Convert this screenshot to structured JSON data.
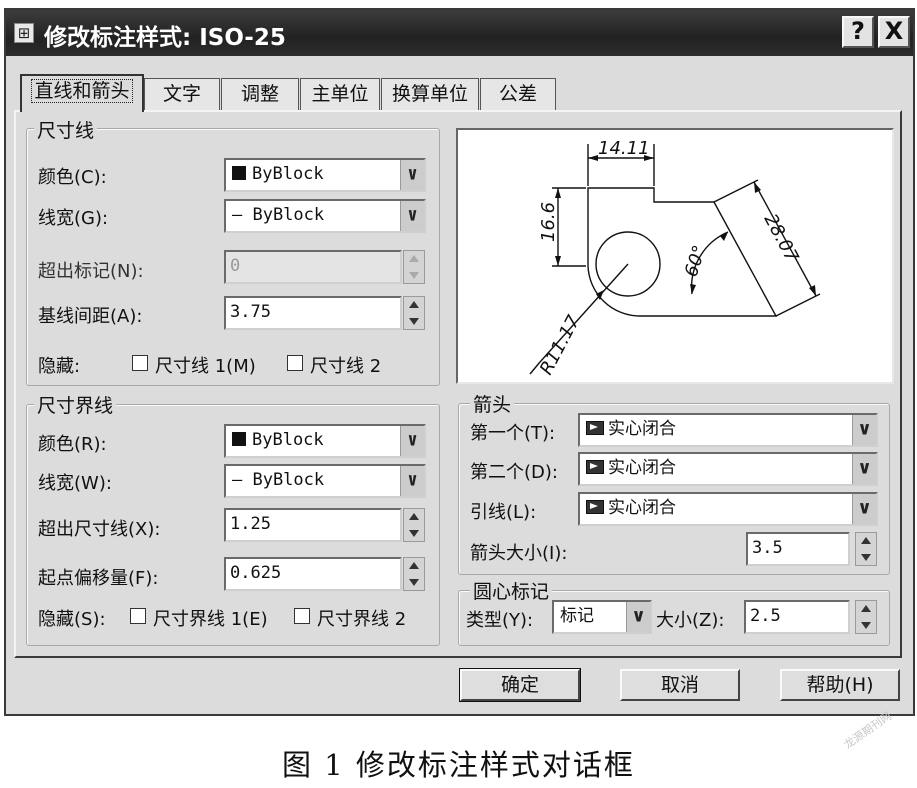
{
  "window": {
    "title": "修改标注样式: ISO-25",
    "icon": "dimension-style-icon",
    "help_label": "?",
    "close_label": "X"
  },
  "tabs": [
    {
      "label": "直线和箭头",
      "active": true
    },
    {
      "label": "文字",
      "active": false
    },
    {
      "label": "调整",
      "active": false
    },
    {
      "label": "主单位",
      "active": false
    },
    {
      "label": "换算单位",
      "active": false
    },
    {
      "label": "公差",
      "active": false
    }
  ],
  "dim_line": {
    "group_label": "尺寸线",
    "color_label": "颜色(C):",
    "color_value": "ByBlock",
    "lineweight_label": "线宽(G):",
    "lineweight_value": "— ByBlock",
    "extend_label": "超出标记(N):",
    "extend_value": "0",
    "baseline_label": "基线间距(A):",
    "baseline_value": "3.75",
    "suppress_label": "隐藏:",
    "suppress1_label": "尺寸线 1(M)",
    "suppress2_label": "尺寸线 2"
  },
  "ext_line": {
    "group_label": "尺寸界线",
    "color_label": "颜色(R):",
    "color_value": "ByBlock",
    "lineweight_label": "线宽(W):",
    "lineweight_value": "— ByBlock",
    "extend_label": "超出尺寸线(X):",
    "extend_value": "1.25",
    "offset_label": "起点偏移量(F):",
    "offset_value": "0.625",
    "suppress_label": "隐藏(S):",
    "suppress1_label": "尺寸界线 1(E)",
    "suppress2_label": "尺寸界线 2"
  },
  "preview": {
    "dim_top": "14.11",
    "dim_left": "16.6",
    "dim_right": "28.07",
    "dim_angle": "60°",
    "dim_radius": "R11.17"
  },
  "arrows": {
    "group_label": "箭头",
    "first_label": "第一个(T):",
    "first_value": "实心闭合",
    "second_label": "第二个(D):",
    "second_value": "实心闭合",
    "leader_label": "引线(L):",
    "leader_value": "实心闭合",
    "size_label": "箭头大小(I):",
    "size_value": "3.5"
  },
  "center": {
    "group_label": "圆心标记",
    "type_label": "类型(Y):",
    "type_value": "标记",
    "size_label": "大小(Z):",
    "size_value": "2.5"
  },
  "buttons": {
    "ok": "确定",
    "cancel": "取消",
    "help": "帮助(H)"
  },
  "caption": "图 1  修改标注样式对话框",
  "watermark": "龙源期刊网"
}
